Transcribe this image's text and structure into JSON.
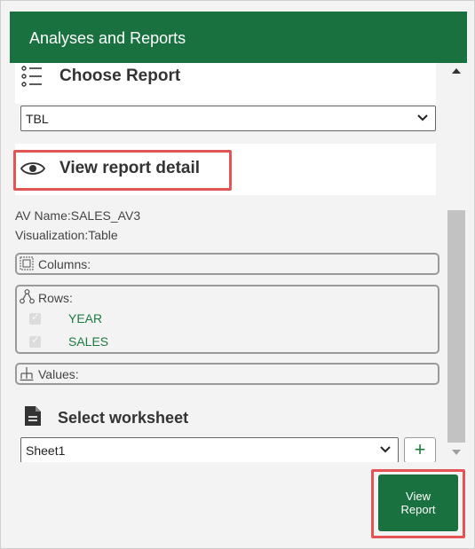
{
  "header": {
    "title": "Analyses and Reports"
  },
  "choose_report": {
    "title": "Choose Report",
    "icon": "list-icon",
    "selected": "TBL"
  },
  "report_detail": {
    "title": "View report detail",
    "icon": "eye-icon",
    "av_name": "AV Name:SALES_AV3",
    "visualization": "Visualization:Table",
    "columns": {
      "label": "Columns:",
      "items": []
    },
    "rows": {
      "label": "Rows:",
      "items": [
        {
          "label": "YEAR",
          "checked": true
        },
        {
          "label": "SALES",
          "checked": true
        }
      ]
    },
    "values": {
      "label": "Values:",
      "items": []
    }
  },
  "worksheet": {
    "title": "Select worksheet",
    "icon": "document-icon",
    "selected": "Sheet1",
    "add_label": "+"
  },
  "actions": {
    "view_report_line1": "View",
    "view_report_line2": "Report"
  },
  "colors": {
    "brand": "#19713f",
    "highlight": "#e55454",
    "field_text": "#1b7a3e"
  }
}
